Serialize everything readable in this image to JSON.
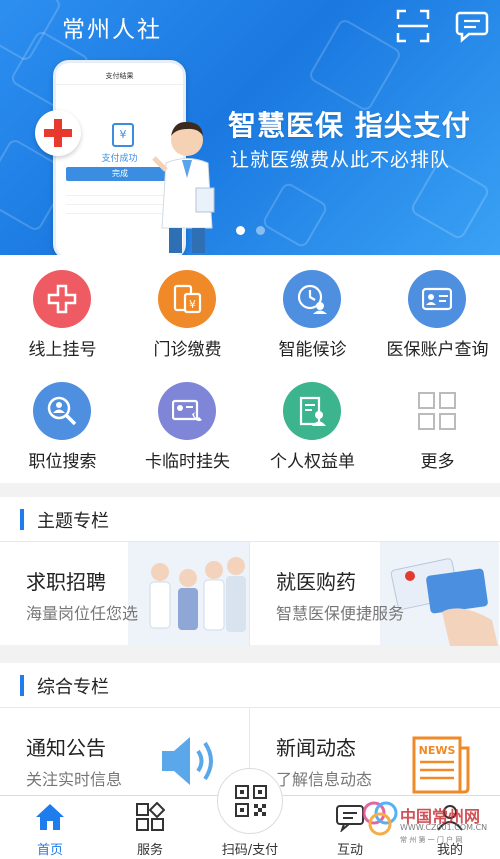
{
  "header": {
    "app_title": "常州人社",
    "scan_icon": "scan-icon",
    "message_icon": "message-icon"
  },
  "banner": {
    "slogan_main": "智慧医保  指尖支付",
    "slogan_sub": "让就医缴费从此不必排队",
    "phone_screen_title": "支付结果",
    "phone_pay_status": "支付成功",
    "phone_done_button": "完成",
    "active_slide": 1,
    "slide_count": 2
  },
  "services": [
    {
      "label": "线上挂号",
      "icon": "hospital-register-icon",
      "color": "#ef5b63"
    },
    {
      "label": "门诊缴费",
      "icon": "payment-bill-icon",
      "color": "#f08a28"
    },
    {
      "label": "智能候诊",
      "icon": "clock-user-icon",
      "color": "#4f8fe0"
    },
    {
      "label": "医保账户查询",
      "icon": "id-card-icon",
      "color": "#4f8fe0"
    },
    {
      "label": "职位搜索",
      "icon": "search-person-icon",
      "color": "#4f8fe0"
    },
    {
      "label": "卡临时挂失",
      "icon": "card-phone-icon",
      "color": "#7f86d8"
    },
    {
      "label": "个人权益单",
      "icon": "rights-document-icon",
      "color": "#3cb48e"
    },
    {
      "label": "更多",
      "icon": "more-grid-icon",
      "color": "#c8c8c8"
    }
  ],
  "section_topics": {
    "title": "主题专栏",
    "cards": [
      {
        "title": "求职招聘",
        "subtitle": "海量岗位任您选"
      },
      {
        "title": "就医购药",
        "subtitle": "智慧医保便捷服务"
      }
    ]
  },
  "section_general": {
    "title": "综合专栏",
    "cards": [
      {
        "title": "通知公告",
        "subtitle": "关注实时信息"
      },
      {
        "title": "新闻动态",
        "subtitle": "了解信息动态"
      }
    ]
  },
  "bottom_nav": [
    {
      "label": "首页",
      "icon": "home-icon",
      "active": true
    },
    {
      "label": "服务",
      "icon": "services-grid-icon",
      "active": false
    },
    {
      "label": "扫码/支付",
      "icon": "qr-code-icon",
      "active": false
    },
    {
      "label": "互动",
      "icon": "chat-icon",
      "active": false
    },
    {
      "label": "我的",
      "icon": "profile-icon",
      "active": false
    }
  ],
  "watermark": {
    "name": "中国常州网",
    "url": "WWW.CZ001.COM.CN",
    "tagline": "常 州 第 一 门 户 网"
  },
  "colors": {
    "accent": "#1f7cec",
    "banner": "#1a78e0",
    "active_nav": "#1f7cec"
  }
}
